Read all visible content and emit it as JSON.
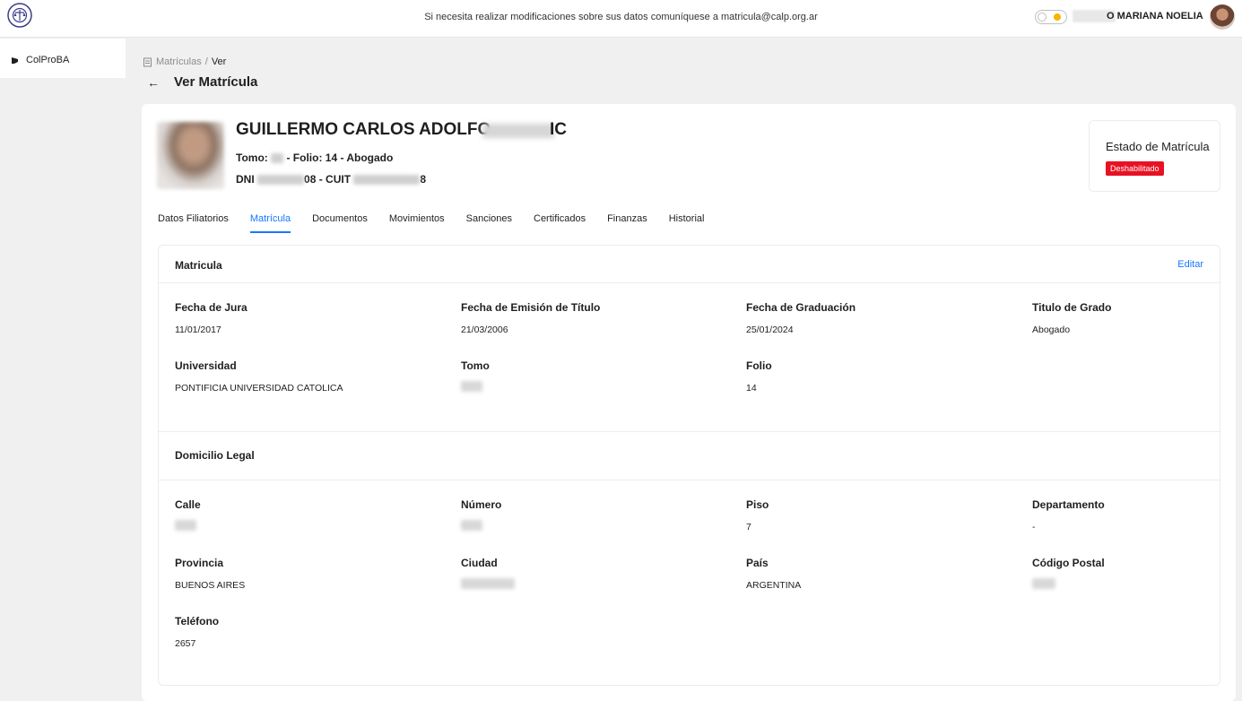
{
  "topbar": {
    "notice": "Si necesita realizar modificaciones sobre sus datos comuníquese a matricula@calp.org.ar",
    "user_name": "O MARIANA NOELIA",
    "logo_icon": "seal-logo-icon",
    "theme_toggle_icon": "sun-icon"
  },
  "sidebar": {
    "items": [
      {
        "label": "ColProBA",
        "icon": "dot-icon"
      }
    ]
  },
  "breadcrumb": {
    "parent": "Matrículas",
    "separator": "/",
    "current": "Ver"
  },
  "page": {
    "title": "Ver Matrícula"
  },
  "person": {
    "name": "GUILLERMO CARLOS ADOLFO",
    "name_suffix": "IC",
    "tomo_prefix": "Tomo:",
    "tomo_rest": "- Folio: 14 - Abogado",
    "dni_prefix": "DNI",
    "dni_mid": "08 - CUIT",
    "dni_end": "8"
  },
  "estado": {
    "label": "Estado de Matrícula",
    "badge": "Deshabilitado",
    "badge_color": "#e81123"
  },
  "tabs": [
    "Datos Filiatorios",
    "Matrícula",
    "Documentos",
    "Movimientos",
    "Sanciones",
    "Certificados",
    "Finanzas",
    "Historial"
  ],
  "active_tab": "Matrícula",
  "matricula": {
    "title": "Matricula",
    "edit_label": "Editar",
    "fields": {
      "fecha_jura": {
        "label": "Fecha de Jura",
        "value": "11/01/2017"
      },
      "fecha_emision": {
        "label": "Fecha de Emisión de Título",
        "value": "21/03/2006"
      },
      "fecha_graduacion": {
        "label": "Fecha de Graduación",
        "value": "25/01/2024"
      },
      "titulo": {
        "label": "Titulo de Grado",
        "value": "Abogado"
      },
      "universidad": {
        "label": "Universidad",
        "value": "PONTIFICIA UNIVERSIDAD CATOLICA"
      },
      "tomo": {
        "label": "Tomo",
        "value": ""
      },
      "folio": {
        "label": "Folio",
        "value": "14"
      }
    }
  },
  "domicilio": {
    "title": "Domicilio Legal",
    "fields": {
      "calle": {
        "label": "Calle",
        "value": ""
      },
      "numero": {
        "label": "Número",
        "value": ""
      },
      "piso": {
        "label": "Piso",
        "value": "7"
      },
      "departamento": {
        "label": "Departamento",
        "value": "-"
      },
      "provincia": {
        "label": "Provincia",
        "value": "BUENOS AIRES"
      },
      "ciudad": {
        "label": "Ciudad",
        "value": ""
      },
      "pais": {
        "label": "País",
        "value": "ARGENTINA"
      },
      "codigo_postal": {
        "label": "Código Postal",
        "value": ""
      },
      "telefono": {
        "label": "Teléfono",
        "value": "2657"
      }
    }
  },
  "colors": {
    "accent": "#1677ff",
    "danger": "#e81123"
  }
}
